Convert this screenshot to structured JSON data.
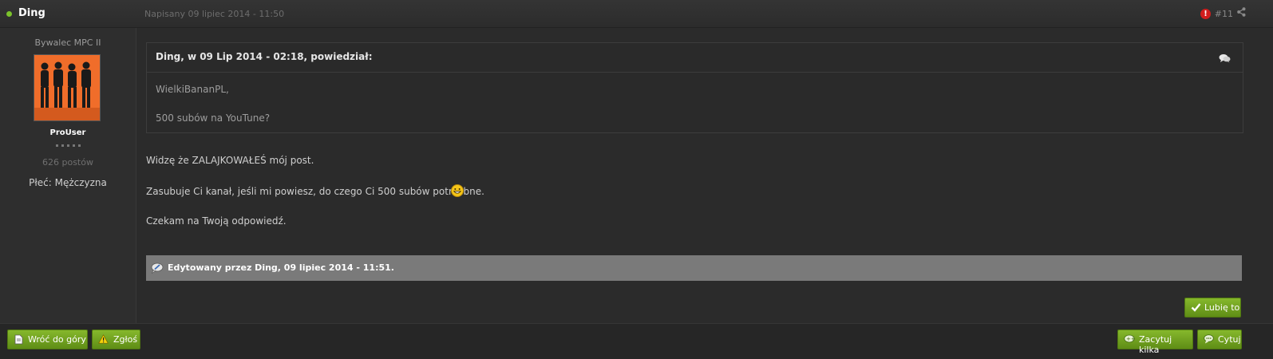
{
  "header": {
    "author": "Ding",
    "date": "Napisany 09 lipiec 2014 - 11:50",
    "post_number": "#11",
    "report_icon_char": "!"
  },
  "sidebar": {
    "member_title": "Bywalec MPC II",
    "group": "ProUser",
    "posts": "626 postów",
    "gender": "Płeć: Mężczyzna"
  },
  "quote": {
    "citation": "Ding, w 09 Lip 2014 - 02:18, powiedział:",
    "line1": "WielkiBananPL,",
    "line2": "500 subów na YouTune?"
  },
  "body": {
    "line1": "Widzę że ZALAJKOWAŁEŚ mój post.",
    "line2": "Zasubuje Ci kanał, jeśli mi powiesz, do czego Ci 500 subów potrzebne.",
    "line3": "Czekam na Twoją odpowiedź."
  },
  "edit_note": "Edytowany przez Ding, 09 lipiec 2014 - 11:51.",
  "buttons": {
    "like": "Lubię to",
    "back_to_top": "Wróć do góry",
    "report": "Zgłoś",
    "multiquote": "Zacytuj kilka",
    "quote": "Cytuj"
  },
  "colors": {
    "online": "#7bc32b",
    "button_green": "#6f9f1f",
    "avatar_bg": "#f06d2a"
  }
}
